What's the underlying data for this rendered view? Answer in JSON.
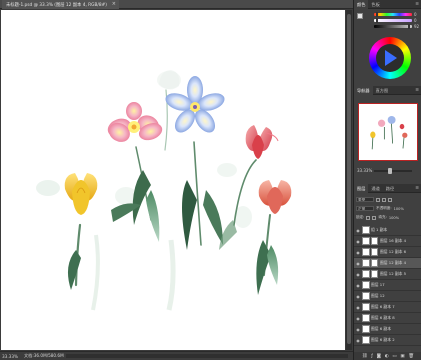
{
  "document": {
    "tab_title": "未标题-1.psd @ 33.3% (图层 12 副本 4, RGB/8#)",
    "status_zoom": "33.33%",
    "status_doc": "文档:36.0M/580.6M",
    "status_arrow": ">"
  },
  "color_panel": {
    "tabs": [
      "颜色",
      "色板"
    ],
    "slider_values": [
      "0",
      "0",
      "92"
    ]
  },
  "navigator": {
    "tabs": [
      "导航器",
      "直方图"
    ],
    "zoom": "33.33%"
  },
  "layers_panel": {
    "tabs": [
      "图层",
      "通道",
      "路径"
    ],
    "kind_label": "类型",
    "blend_mode": "正常",
    "opacity_label": "不透明度:",
    "opacity_value": "100%",
    "lock_label": "锁定:",
    "fill_label": "填充:",
    "fill_value": "100%",
    "layers": [
      {
        "name": "组 1 副本",
        "selected": false,
        "has_mask": false
      },
      {
        "name": "图层 16 副本 4",
        "selected": false,
        "has_mask": true
      },
      {
        "name": "图层 12 副本 6",
        "selected": false,
        "has_mask": true
      },
      {
        "name": "图层 12 副本 4",
        "selected": true,
        "has_mask": true
      },
      {
        "name": "图层 12 副本 5",
        "selected": false,
        "has_mask": true
      },
      {
        "name": "图层 17",
        "selected": false,
        "has_mask": false
      },
      {
        "name": "图层 12",
        "selected": false,
        "has_mask": false
      },
      {
        "name": "图层 6 副本 7",
        "selected": false,
        "has_mask": false
      },
      {
        "name": "图层 6 副本 8",
        "selected": false,
        "has_mask": false
      },
      {
        "name": "图层 6 副本",
        "selected": false,
        "has_mask": false
      },
      {
        "name": "图层 6 副本 2",
        "selected": false,
        "has_mask": false
      }
    ],
    "footer_icons": [
      "link-icon",
      "fx-icon",
      "mask-icon",
      "adjustment-icon",
      "folder-icon",
      "new-layer-icon",
      "trash-icon"
    ]
  },
  "flowers": {
    "accent_red": "#d9404a",
    "accent_blue": "#6a8fd8",
    "accent_yellow": "#f1c52b",
    "stem_green": "#3d6b4c"
  }
}
